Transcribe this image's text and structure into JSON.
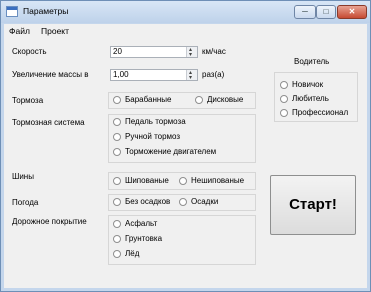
{
  "window": {
    "title": "Параметры",
    "min_symbol": "─",
    "max_symbol": "□",
    "close_symbol": "✕"
  },
  "menu": [
    "Файл",
    "Проект"
  ],
  "form": {
    "speed": {
      "label": "Скорость",
      "value": "20",
      "unit": "км/час"
    },
    "mass": {
      "label": "Увеличение массы в",
      "value": "1,00",
      "unit": "раз(а)"
    },
    "brakes": {
      "label": "Тормоза",
      "options": [
        "Барабанные",
        "Дисковые"
      ]
    },
    "brake_system": {
      "label": "Тормозная система",
      "options": [
        "Педаль тормоза",
        "Ручной тормоз",
        "Торможение двигателем"
      ]
    },
    "tires": {
      "label": "Шины",
      "options": [
        "Шипованые",
        "Нешипованые"
      ]
    },
    "weather": {
      "label": "Погода",
      "options": [
        "Без осадков",
        "Осадки"
      ]
    },
    "road": {
      "label": "Дорожное покрытие",
      "options": [
        "Асфальт",
        "Грунтовка",
        "Лёд"
      ]
    },
    "driver": {
      "label": "Водитель",
      "options": [
        "Новичок",
        "Любитель",
        "Профессионал"
      ]
    },
    "start_label": "Старт!"
  }
}
